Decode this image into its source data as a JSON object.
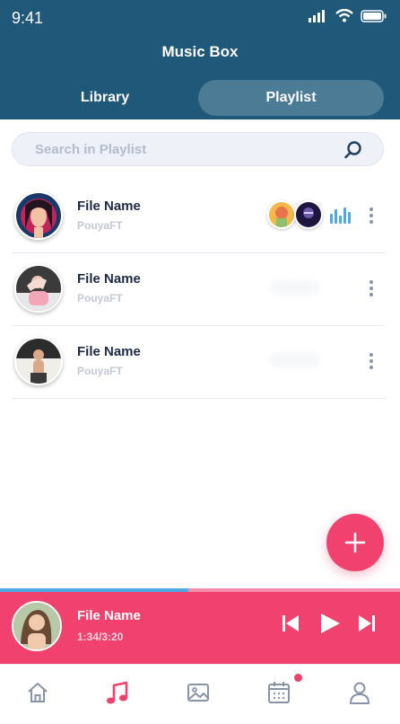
{
  "status_bar": {
    "time": "9:41"
  },
  "header": {
    "title": "Music Box"
  },
  "tabs": [
    {
      "label": "Library",
      "active": false
    },
    {
      "label": "Playlist",
      "active": true
    }
  ],
  "search": {
    "placeholder": "Search in Playlist"
  },
  "playlist": [
    {
      "title": "File Name",
      "artist": "PouyaFT",
      "playing": true
    },
    {
      "title": "File Name",
      "artist": "PouyaFT",
      "playing": false
    },
    {
      "title": "File Name",
      "artist": "PouyaFT",
      "playing": false
    }
  ],
  "now_playing": {
    "title": "File Name",
    "time": "1:34/3:20",
    "progress": 0.47
  },
  "bottom_nav": [
    {
      "icon": "home-icon",
      "active": false
    },
    {
      "icon": "music-note-icon",
      "active": true
    },
    {
      "icon": "gallery-icon",
      "active": false
    },
    {
      "icon": "calendar-icon",
      "active": false,
      "badge": true
    },
    {
      "icon": "profile-icon",
      "active": false
    }
  ],
  "colors": {
    "header": "#1f5878",
    "accent": "#f1426f",
    "progress": "#4fa9e0",
    "text_dark": "#1f2a44"
  }
}
